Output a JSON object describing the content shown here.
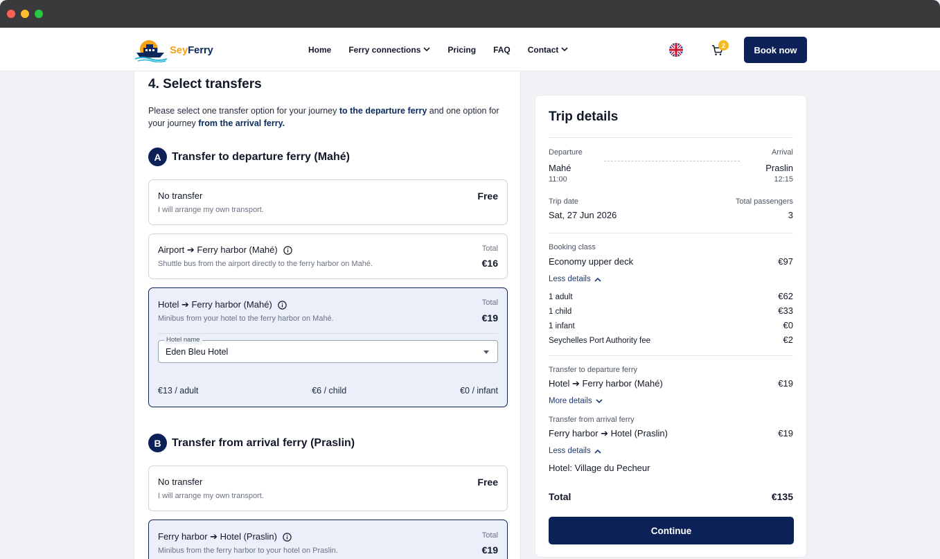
{
  "brand": {
    "name_a": "Sey",
    "name_b": "Ferry"
  },
  "nav": {
    "items": [
      {
        "label": "Home",
        "dropdown": false
      },
      {
        "label": "Ferry connections",
        "dropdown": true
      },
      {
        "label": "Pricing",
        "dropdown": false
      },
      {
        "label": "FAQ",
        "dropdown": false
      },
      {
        "label": "Contact",
        "dropdown": true
      }
    ],
    "cart_count": "2",
    "book_label": "Book now"
  },
  "step": {
    "title": "4. Select transfers",
    "intro_1": "Please select one transfer option for your journey ",
    "intro_b1": "to the departure ferry",
    "intro_2": " and one option for your journey ",
    "intro_b2": "from the arrival ferry."
  },
  "section_a": {
    "badge": "A",
    "title": "Transfer to departure ferry (Mahé)",
    "no_transfer": {
      "title": "No transfer",
      "sub": "I will arrange my own transport.",
      "price": "Free"
    },
    "airport": {
      "title": "Airport ➔ Ferry harbor (Mahé)",
      "sub": "Shuttle bus from the airport directly to the ferry harbor on Mahé.",
      "price_label": "Total",
      "price": "€16"
    },
    "hotel": {
      "title": "Hotel ➔ Ferry harbor (Mahé)",
      "sub": "Minibus from your hotel to the ferry harbor on Mahé.",
      "price_label": "Total",
      "price": "€19",
      "hotel_label": "Hotel name",
      "hotel_value": "Eden Bleu Hotel",
      "rate_adult": "€13 / adult",
      "rate_child": "€6 / child",
      "rate_infant": "€0 / infant"
    }
  },
  "section_b": {
    "badge": "B",
    "title": "Transfer from arrival ferry (Praslin)",
    "no_transfer": {
      "title": "No transfer",
      "sub": "I will arrange my own transport.",
      "price": "Free"
    },
    "hotel": {
      "title": "Ferry harbor ➔ Hotel (Praslin)",
      "sub": "Minibus from the ferry harbor to your hotel on Praslin.",
      "price_label": "Total",
      "price": "€19"
    }
  },
  "trip": {
    "title": "Trip details",
    "departure_label": "Departure",
    "arrival_label": "Arrival",
    "from": "Mahé",
    "to": "Praslin",
    "dep_time": "11:00",
    "arr_time": "12:15",
    "date_label": "Trip date",
    "date": "Sat, 27 Jun 2026",
    "pax_label": "Total passengers",
    "pax": "3",
    "class_label": "Booking class",
    "class": "Economy upper deck",
    "class_price": "€97",
    "less_details": "Less details",
    "more_details": "More details",
    "breakdown": [
      {
        "label": "1 adult",
        "price": "€62"
      },
      {
        "label": "1 child",
        "price": "€33"
      },
      {
        "label": "1 infant",
        "price": "€0"
      },
      {
        "label": "Seychelles Port Authority fee",
        "price": "€2"
      }
    ],
    "dep_transfer_label": "Transfer to departure ferry",
    "dep_transfer": "Hotel ➔ Ferry harbor (Mahé)",
    "dep_transfer_price": "€19",
    "arr_transfer_label": "Transfer from arrival ferry",
    "arr_transfer": "Ferry harbor ➔ Hotel (Praslin)",
    "arr_transfer_price": "€19",
    "arr_hotel": "Hotel: Village du Pecheur",
    "total_label": "Total",
    "total": "€135",
    "continue_label": "Continue"
  }
}
